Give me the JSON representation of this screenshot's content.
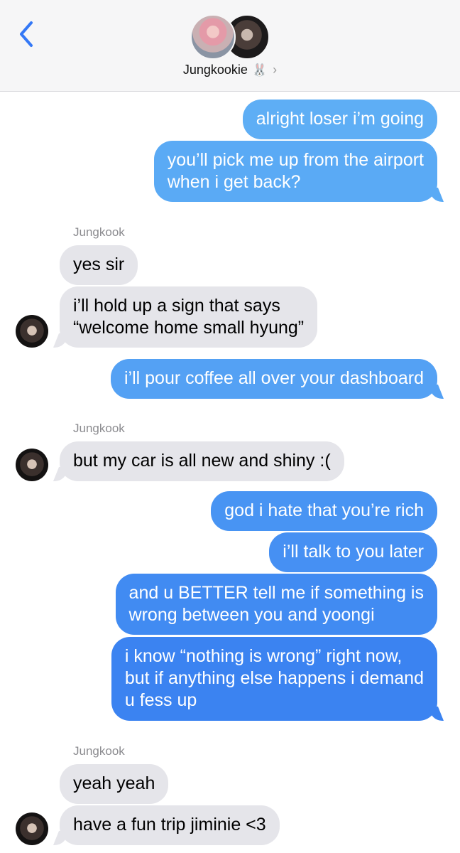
{
  "header": {
    "contact_name": "Jungkookie",
    "emoji": "🐰",
    "chevron": "›"
  },
  "colors": {
    "accent_blue": "#3478f6",
    "incoming_bubble": "#e5e5ea"
  },
  "conversation": [
    {
      "id": "m1",
      "direction": "out",
      "text": "alright loser i’m going"
    },
    {
      "id": "m2",
      "direction": "out",
      "text": "you’ll pick me up from the airport\nwhen i get back?"
    },
    {
      "id": "s1",
      "type": "sender",
      "text": "Jungkook"
    },
    {
      "id": "m3",
      "direction": "in",
      "text": "yes sir"
    },
    {
      "id": "m4",
      "direction": "in",
      "text": "i’ll hold up a sign that says\n“welcome home small hyung”"
    },
    {
      "id": "m5",
      "direction": "out",
      "text": "i’ll pour coffee all over your dashboard"
    },
    {
      "id": "s2",
      "type": "sender",
      "text": "Jungkook"
    },
    {
      "id": "m6",
      "direction": "in",
      "text": "but my car is all new and shiny :("
    },
    {
      "id": "m7",
      "direction": "out",
      "text": "god i hate that you’re rich"
    },
    {
      "id": "m8",
      "direction": "out",
      "text": "i’ll talk to you later"
    },
    {
      "id": "m9",
      "direction": "out",
      "text": "and u BETTER tell me if something is\nwrong between you and yoongi"
    },
    {
      "id": "m10",
      "direction": "out",
      "text": "i know “nothing is wrong” right now,\nbut if anything else happens i demand\nu fess up"
    },
    {
      "id": "s3",
      "type": "sender",
      "text": "Jungkook"
    },
    {
      "id": "m11",
      "direction": "in",
      "text": "yeah yeah"
    },
    {
      "id": "m12",
      "direction": "in",
      "text": "have a fun trip jiminie <3"
    }
  ]
}
